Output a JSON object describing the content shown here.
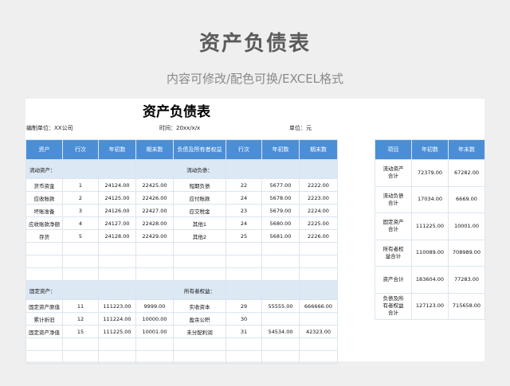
{
  "banner": {
    "title": "资产负债表",
    "subtitle": "内容可修改/配色可换/EXCEL格式"
  },
  "sheet": {
    "title": "资产负债表",
    "unit_label": "编制单位：",
    "unit_value": "XX公司",
    "time_label": "时间：",
    "time_value": "20xx/x/x",
    "currency_label": "单位：",
    "currency_value": "元"
  },
  "main_table": {
    "headers": [
      "资产",
      "行次",
      "年初数",
      "期末数",
      "负债及所有者权益",
      "行次",
      "年初数",
      "期末数"
    ],
    "section1": {
      "left": "流动资产：",
      "right": "流动负债："
    },
    "rows1": [
      [
        "货币资金",
        "1",
        "24124.00",
        "22425.00",
        "短期负债",
        "22",
        "5677.00",
        "2222.00"
      ],
      [
        "应收账款",
        "2",
        "24125.00",
        "22426.00",
        "应付账款",
        "24",
        "5678.00",
        "2223.00"
      ],
      [
        "坏账准备",
        "3",
        "24126.00",
        "22427.00",
        "应交税金",
        "23",
        "5679.00",
        "2224.00"
      ],
      [
        "应收账款净额",
        "4",
        "24127.00",
        "22428.00",
        "其他1",
        "24",
        "5680.00",
        "2225.00"
      ],
      [
        "存货",
        "5",
        "24128.00",
        "22429.00",
        "其他2",
        "25",
        "5681.00",
        "2226.00"
      ],
      [
        "",
        "",
        "",
        "",
        "",
        "",
        "",
        ""
      ],
      [
        "",
        "",
        "",
        "",
        "",
        "",
        "",
        ""
      ],
      [
        "",
        "",
        "",
        "",
        "",
        "",
        "",
        ""
      ]
    ],
    "section2": {
      "left": "固定资产：",
      "right": "所有者权益："
    },
    "rows2": [
      [
        "固定资产原值",
        "11",
        "111223.00",
        "9999.00",
        "实收资本",
        "29",
        "55555.00",
        "666666.00"
      ],
      [
        "累计折旧",
        "12",
        "111224.00",
        "10000.00",
        "盈余公积",
        "30",
        "",
        ""
      ],
      [
        "固定资产净值",
        "15",
        "111225.00",
        "10001.00",
        "未分配利润",
        "31",
        "54534.00",
        "42323.00"
      ],
      [
        "",
        "",
        "",
        "",
        "",
        "",
        "",
        ""
      ],
      [
        "",
        "",
        "",
        "",
        "",
        "",
        "",
        ""
      ]
    ]
  },
  "side_table": {
    "headers": [
      "项目",
      "年初数",
      "年末数"
    ],
    "rows": [
      [
        "流动资产合计",
        "72379.00",
        "67282.00"
      ],
      [
        "流动负债合计",
        "17034.00",
        "6669.00"
      ],
      [
        "固定资产合计",
        "111225.00",
        "10001.00"
      ],
      [
        "所有者权益合计",
        "110089.00",
        "708989.00"
      ],
      [
        "资产合计",
        "183604.00",
        "77283.00"
      ],
      [
        "负债及所有者权益合计",
        "127123.00",
        "715658.00"
      ]
    ]
  },
  "colors": {
    "header_blue": "#4a8fd6",
    "section_fill": "#dce8f4",
    "background": "#efefef"
  }
}
